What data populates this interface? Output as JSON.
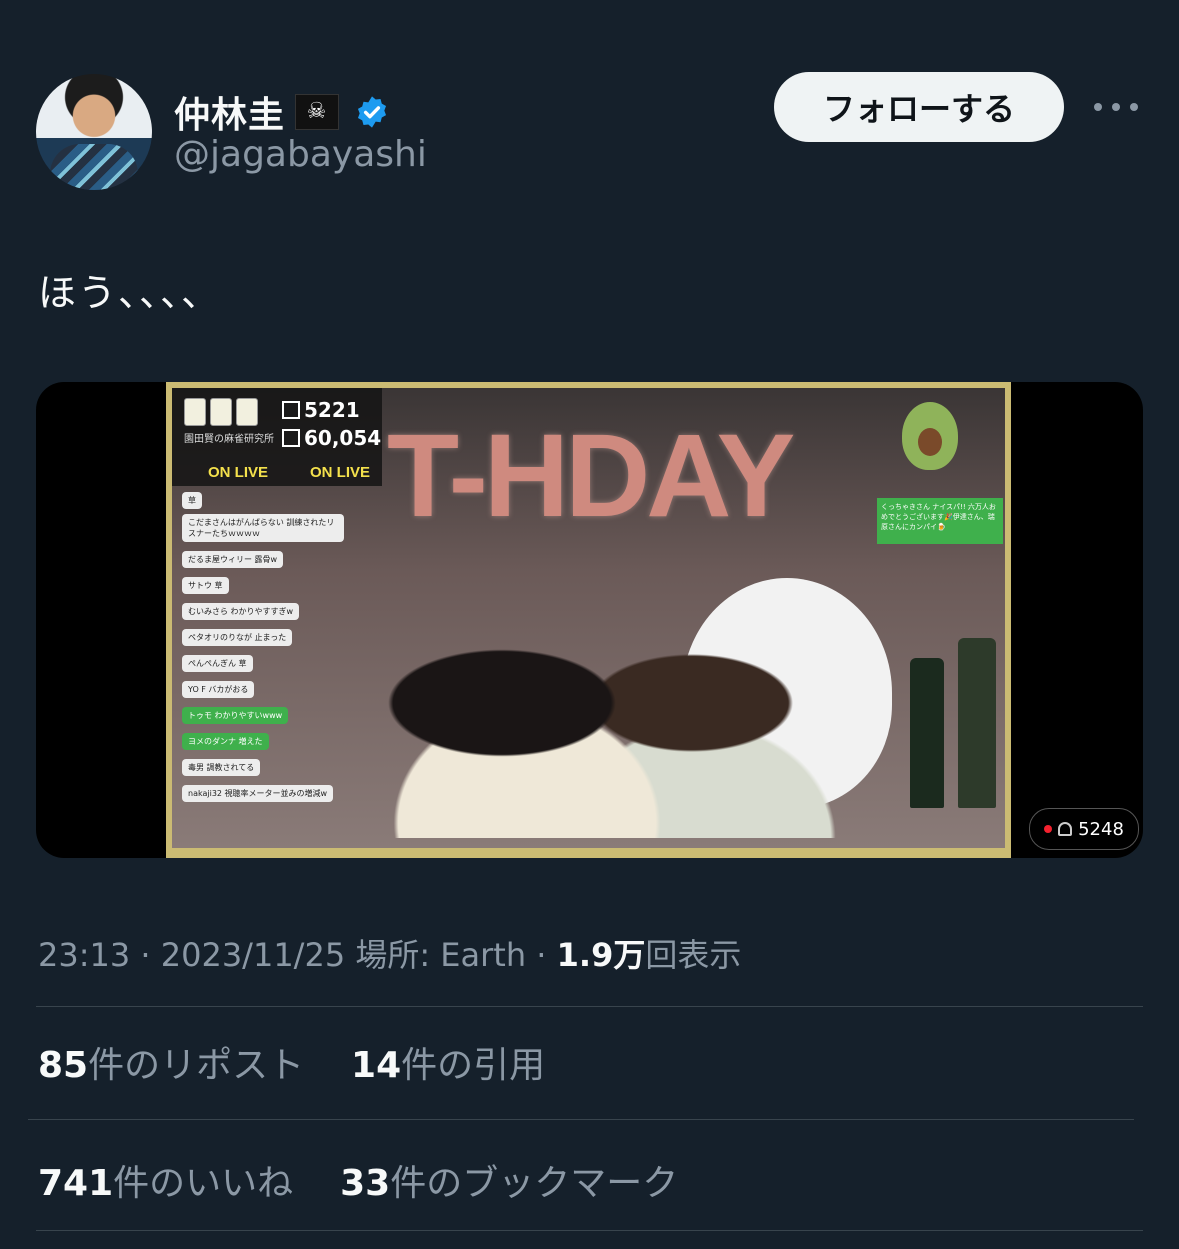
{
  "user": {
    "display_name": "仲林圭",
    "flag_glyph": "☠",
    "handle": "@jagabayashi",
    "verified": true,
    "verified_color": "#1d9bf0"
  },
  "follow_label": "フォローする",
  "tweet": {
    "text": "ほう、、、、"
  },
  "media": {
    "overlay": {
      "stat1": "5221",
      "stat2": "60,054",
      "studio": "園田賢の麻雀研究所",
      "on_live_1": "ON LIVE",
      "on_live_2": "ON LIVE",
      "balloon": "T-HDAY",
      "side_msg": "くっちゃきさん ナイスパ!! 六万人おめでとうございます🎉伊達さん、瑞原さんにカンパイ🍺",
      "chat": [
        {
          "text": "草",
          "green": false
        },
        {
          "text": "こだまさんはがんばらない 訓練されたリスナーたちｗｗｗｗ",
          "green": false
        },
        {
          "text": "だるま屋ウィリー 露骨w",
          "green": false
        },
        {
          "text": "サトウ 草",
          "green": false
        },
        {
          "text": "むいみさら わかりやすすぎw",
          "green": false
        },
        {
          "text": "ペタオリのりなが 止まった",
          "green": false
        },
        {
          "text": "ぺんぺんぎん 草",
          "green": false
        },
        {
          "text": "YO F バカがおる",
          "green": false
        },
        {
          "text": "トゥモ わかりやすいwww",
          "green": true
        },
        {
          "text": "ヨメのダンナ 増えた",
          "green": true
        },
        {
          "text": "毒男 調教されてる",
          "green": false
        },
        {
          "text": "nakaji32 視聴率メーター並みの増減w",
          "green": false
        }
      ]
    },
    "viewers": "5248"
  },
  "meta": {
    "time": "23:13",
    "date": "2023/11/25",
    "location": "場所: Earth",
    "views_count": "1.9万",
    "views_label": "回表示"
  },
  "stats": {
    "reposts_count": "85",
    "reposts_label": "件のリポスト",
    "quotes_count": "14",
    "quotes_label": "件の引用",
    "likes_count": "741",
    "likes_label": "件のいいね",
    "bookmarks_count": "33",
    "bookmarks_label": "件のブックマーク"
  }
}
